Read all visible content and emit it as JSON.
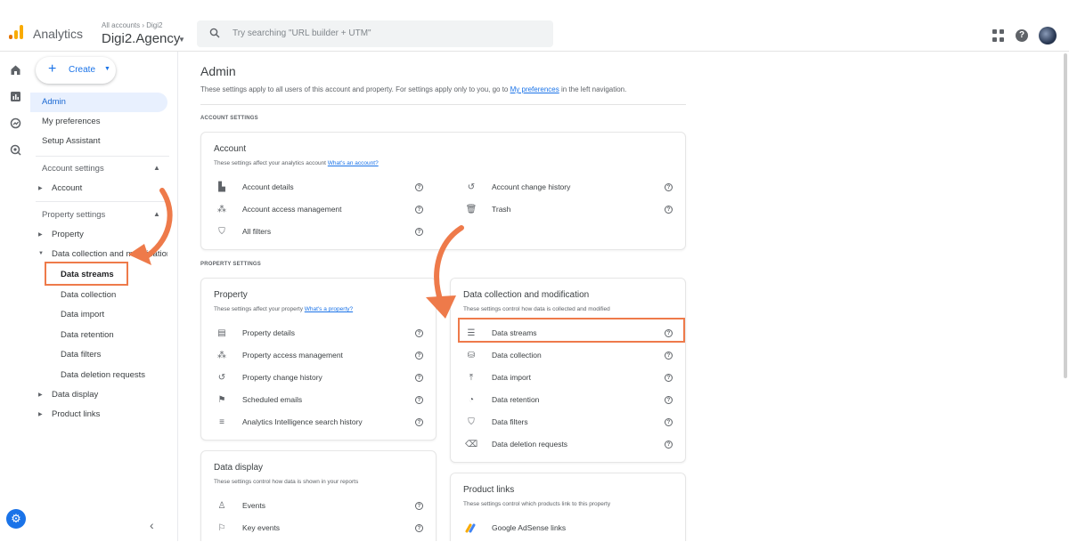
{
  "topbar": {
    "app_name": "Analytics",
    "account_breadcrumb": "All accounts › Digi2",
    "account_name": "Digi2.Agency",
    "search_placeholder": "Try searching \"URL builder + UTM\"",
    "icons": [
      "apps-icon",
      "help-icon",
      "avatar"
    ],
    "brand_colors": [
      "#f9ab00",
      "#e37400"
    ]
  },
  "rail": {
    "icons": [
      "home-icon",
      "reports-icon",
      "explore-icon",
      "advertising-icon",
      "settings-gear-icon"
    ]
  },
  "sidebar": {
    "create_label": "Create",
    "items": [
      {
        "label": "Admin",
        "active": true
      },
      {
        "label": "My preferences"
      },
      {
        "label": "Setup Assistant"
      }
    ],
    "account_settings": {
      "label": "Account settings",
      "children": [
        "Account"
      ]
    },
    "property_settings": {
      "label": "Property settings",
      "property": "Property",
      "data_collection": "Data collection and modification",
      "data_collection_children": [
        "Data streams",
        "Data collection",
        "Data import",
        "Data retention",
        "Data filters",
        "Data deletion requests"
      ],
      "data_display": "Data display",
      "product_links": "Product links"
    },
    "highlight_color": "#ee7a4a"
  },
  "main": {
    "title": "Admin",
    "desc_prefix": "These settings apply to all users of this account and property. For settings apply only to you, go to ",
    "desc_link": "My preferences",
    "desc_suffix": " in the left navigation.",
    "account_section_label": "ACCOUNT SETTINGS",
    "property_section_label": "PROPERTY SETTINGS",
    "account_card": {
      "title": "Account",
      "desc": "These settings affect your analytics account ",
      "desc_link": "What's an account?",
      "left": [
        "Account details",
        "Account access management",
        "All filters"
      ],
      "right": [
        "Account change history",
        "Trash"
      ]
    },
    "property_card": {
      "title": "Property",
      "desc": "These settings affect your property ",
      "desc_link": "What's a property?",
      "items": [
        "Property details",
        "Property access management",
        "Property change history",
        "Scheduled emails",
        "Analytics Intelligence search history"
      ]
    },
    "data_collection_card": {
      "title": "Data collection and modification",
      "desc": "These settings control how data is collected and modified",
      "items": [
        "Data streams",
        "Data collection",
        "Data import",
        "Data retention",
        "Data filters",
        "Data deletion requests"
      ]
    },
    "data_display_card": {
      "title": "Data display",
      "desc": "These settings control how data is shown in your reports",
      "items": [
        "Events",
        "Key events"
      ]
    },
    "product_links_card": {
      "title": "Product links",
      "desc": "These settings control which products link to this property",
      "items": [
        "Google AdSense links"
      ]
    }
  }
}
